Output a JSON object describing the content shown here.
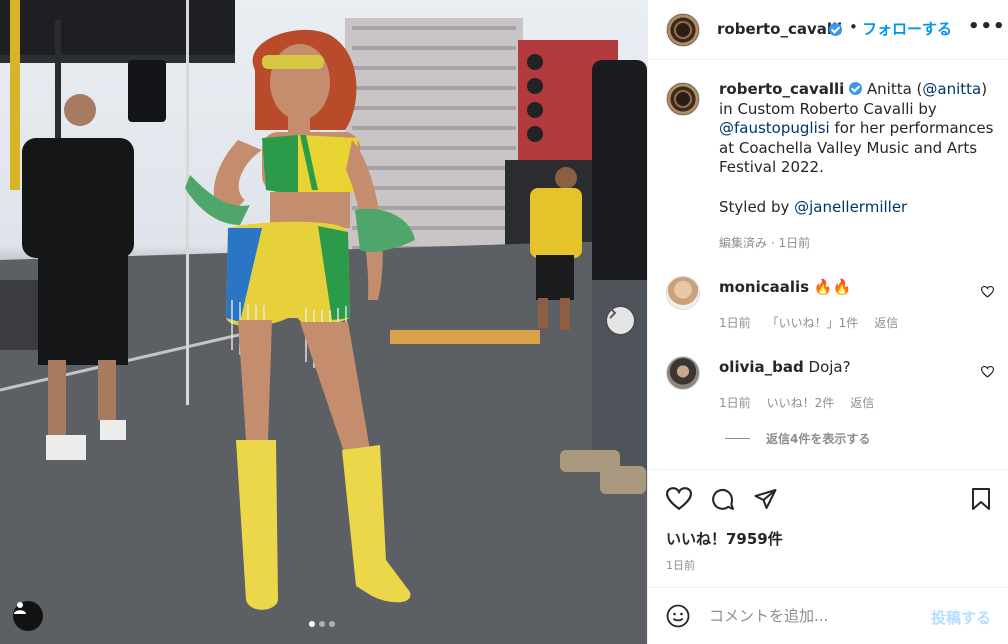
{
  "photo": {
    "alt_icons": [
      "next-arrow-icon",
      "user-tag-icon"
    ],
    "carousel": {
      "total": 3,
      "active": 1
    }
  },
  "header": {
    "username": "roberto_cavalli",
    "separator": "•",
    "follow_label": "フォローする",
    "more_label": "•••"
  },
  "caption": {
    "username": "roberto_cavalli",
    "text_1": " Anitta (",
    "mention_1": "@anitta",
    "text_2": ") in Custom Roberto Cavalli by ",
    "mention_2": "@faustopuglisi",
    "text_3": " for her performances at Coachella Valley Music and Arts Festival 2022.",
    "styled_prefix": "Styled by ",
    "styled_mention": "@janellermiller",
    "meta": "編集済み · 1日前"
  },
  "comments": [
    {
      "username": "monicaalis",
      "text": "🔥🔥",
      "time": "1日前",
      "likes": "「いいね！」1件",
      "reply": "返信"
    },
    {
      "username": "olivia_bad",
      "text": "Doja?",
      "time": "1日前",
      "likes": "いいね！2件",
      "reply": "返信"
    }
  ],
  "view_replies": "返信4件を表示する",
  "actions": {
    "likes": "いいね！7959件",
    "date": "1日前"
  },
  "add_comment": {
    "placeholder": "コメントを追加...",
    "post_label": "投稿する"
  },
  "colors": {
    "accent": "#0095f6",
    "post_disabled": "#b2dffc",
    "verified": "#3897f0"
  }
}
